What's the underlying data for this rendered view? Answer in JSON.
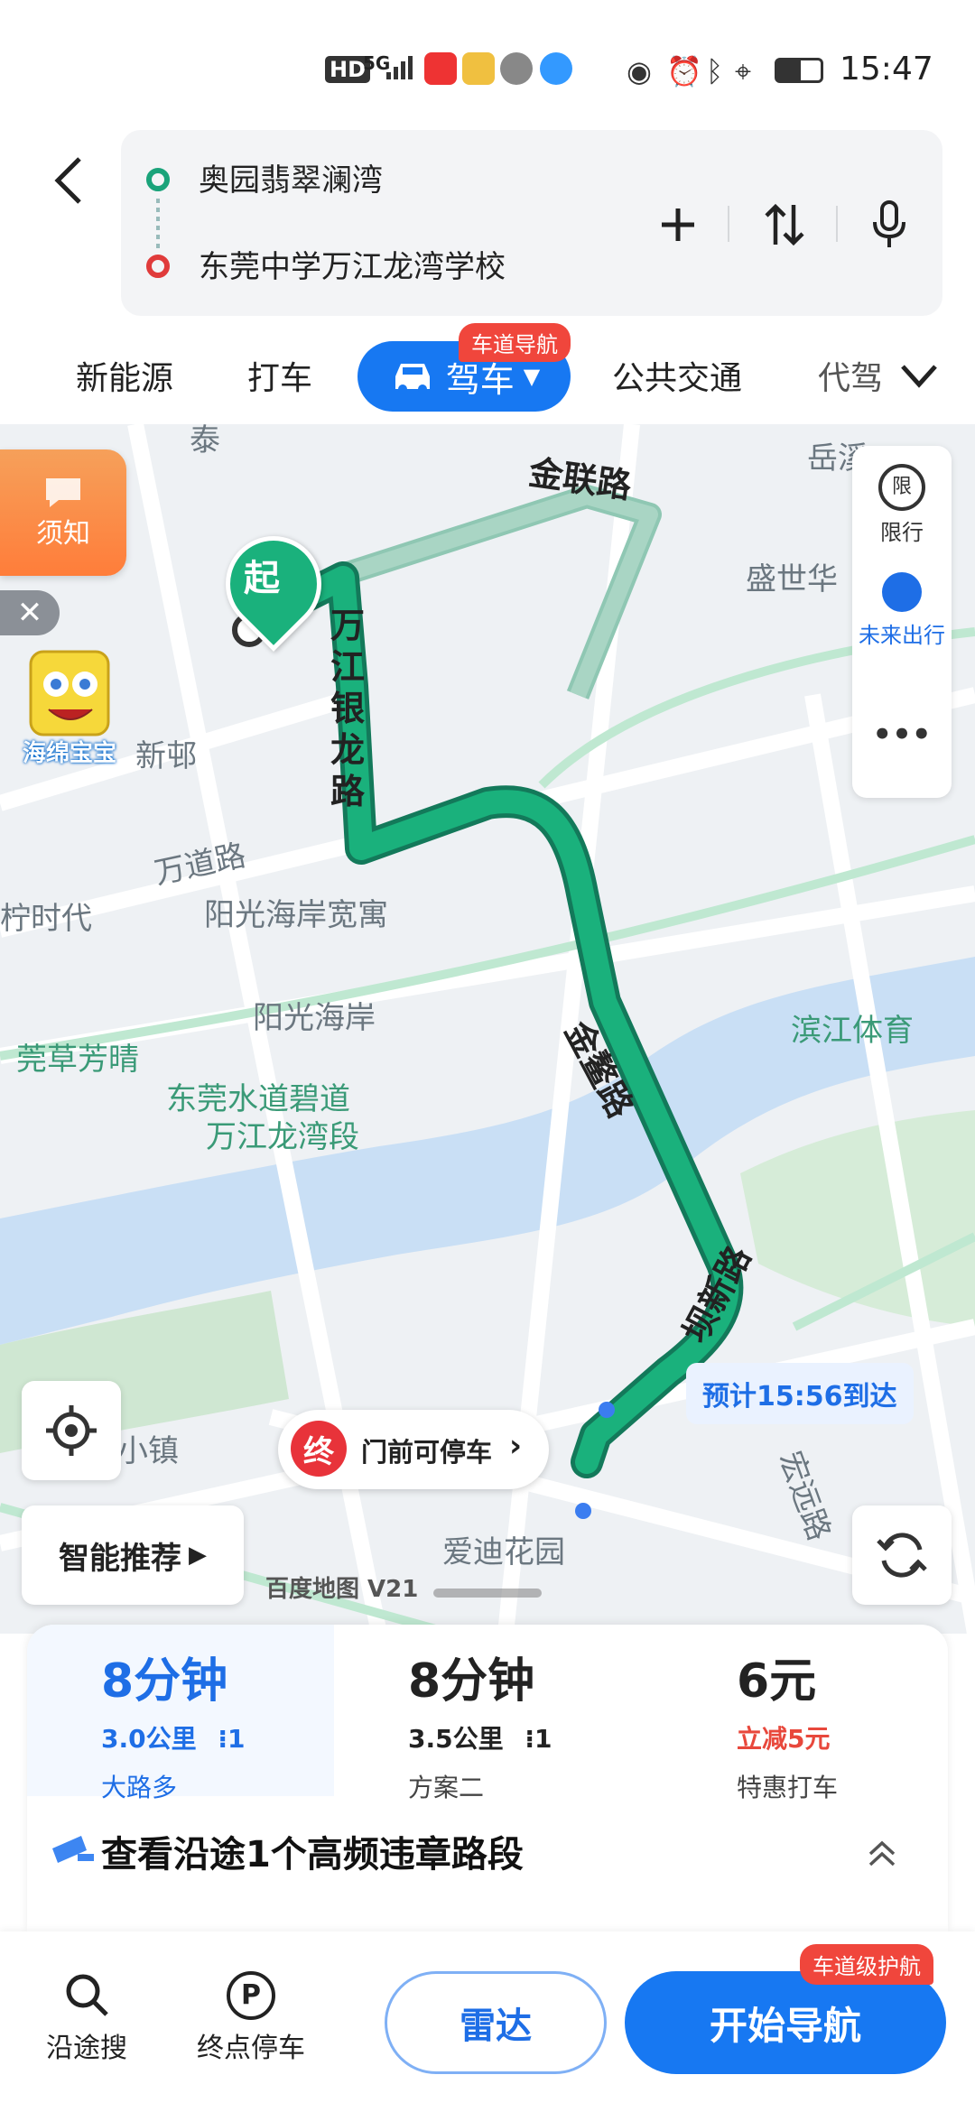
{
  "status_bar": {
    "time": "15:47",
    "hd": "HD",
    "network": "5G"
  },
  "route": {
    "origin": "奥园翡翠澜湾",
    "destination": "东莞中学万江龙湾学校"
  },
  "tabs": {
    "new_energy": "新能源",
    "taxi": "打车",
    "drive": "驾车",
    "lane_badge": "车道导航",
    "transit": "公共交通",
    "proxy": "代驾"
  },
  "map": {
    "notice": "须知",
    "sponge_label": "海绵宝宝",
    "restrict": "限行",
    "future": "未来出行",
    "more": "•••",
    "smart": "智能推荐",
    "eta": "预计15:56到达",
    "park": "门前可停车",
    "end_marker": "终",
    "start_marker": "起",
    "brand": "百度地图 V21",
    "labels": {
      "jinlian": "金联路",
      "wanjiang": "万江银龙路",
      "wandao": "万道路",
      "jinao": "金鳌路",
      "baxin": "坝新路",
      "yuexi": "岳溪",
      "shengshi": "盛世华",
      "yangguang_kuan": "阳光海岸宽寓",
      "yangguang": "阳光海岸",
      "ning": "柠时代",
      "wan_bu": "新邨",
      "cao": "莞草芳晴",
      "shuidao": "东莞水道碧道",
      "wanjiang_seg": "万江龙湾段",
      "binjiang": "滨江体育",
      "aidi": "爱迪花园",
      "xiaozhen": "小镇",
      "hong": "宏远路",
      "tai": "泰"
    }
  },
  "plans": [
    {
      "time": "8分钟",
      "distance": "3.0公里",
      "lights": "1",
      "desc": "大路多",
      "active": true
    },
    {
      "time": "8分钟",
      "distance": "3.5公里",
      "lights": "1",
      "desc": "方案二",
      "active": false
    },
    {
      "time": "6元",
      "distance": "立减5元",
      "lights": "",
      "desc": "特惠打车",
      "active": false
    }
  ],
  "violation": "查看沿途1个高频违章路段",
  "bottom": {
    "search_along": "沿途搜",
    "end_parking": "终点停车",
    "radar": "雷达",
    "start_nav": "开始导航",
    "nav_badge": "车道级护航"
  },
  "colors": {
    "route_green": "#1ab17c",
    "accent_blue": "#1778f2",
    "badge_red": "#f0463c"
  }
}
